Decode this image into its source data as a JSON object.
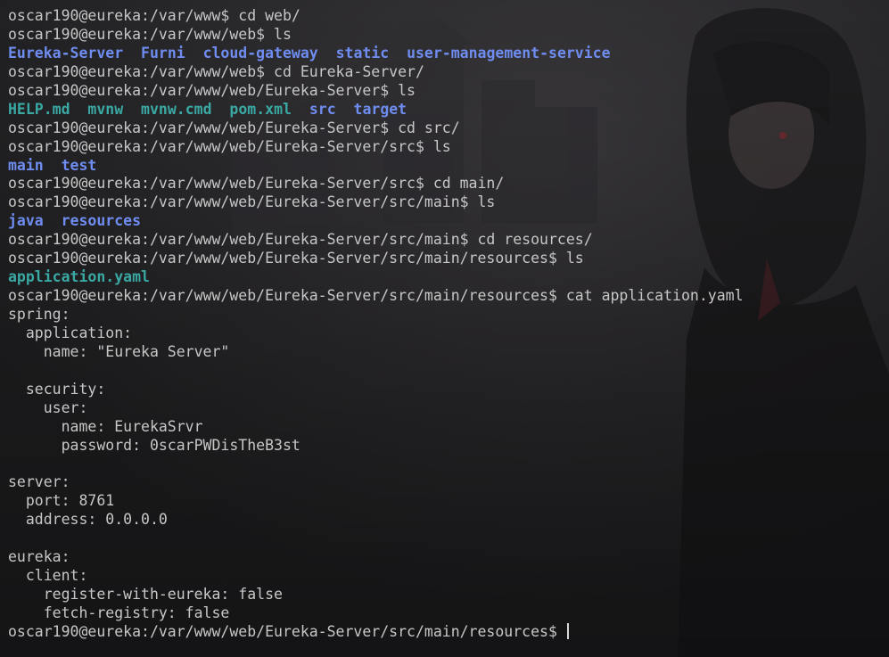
{
  "terminal": {
    "colors": {
      "background": "#232325",
      "text": "#c7c7c7",
      "directory": "#6f8cf0",
      "file": "#3aa8a3"
    },
    "lines": [
      {
        "type": "text",
        "text": "oscar190@eureka:/var/www$ cd web/"
      },
      {
        "type": "text",
        "text": "oscar190@eureka:/var/www/web$ ls"
      },
      {
        "type": "ls",
        "items": [
          {
            "name": "Eureka-Server",
            "kind": "dir"
          },
          {
            "name": "Furni",
            "kind": "dir"
          },
          {
            "name": "cloud-gateway",
            "kind": "dir"
          },
          {
            "name": "static",
            "kind": "dir"
          },
          {
            "name": "user-management-service",
            "kind": "dir"
          }
        ]
      },
      {
        "type": "text",
        "text": "oscar190@eureka:/var/www/web$ cd Eureka-Server/"
      },
      {
        "type": "text",
        "text": "oscar190@eureka:/var/www/web/Eureka-Server$ ls"
      },
      {
        "type": "ls",
        "items": [
          {
            "name": "HELP.md",
            "kind": "file"
          },
          {
            "name": "mvnw",
            "kind": "file"
          },
          {
            "name": "mvnw.cmd",
            "kind": "file"
          },
          {
            "name": "pom.xml",
            "kind": "file"
          },
          {
            "name": "src",
            "kind": "dir"
          },
          {
            "name": "target",
            "kind": "dir"
          }
        ]
      },
      {
        "type": "text",
        "text": "oscar190@eureka:/var/www/web/Eureka-Server$ cd src/"
      },
      {
        "type": "text",
        "text": "oscar190@eureka:/var/www/web/Eureka-Server/src$ ls"
      },
      {
        "type": "ls",
        "items": [
          {
            "name": "main",
            "kind": "dir"
          },
          {
            "name": "test",
            "kind": "dir"
          }
        ]
      },
      {
        "type": "text",
        "text": "oscar190@eureka:/var/www/web/Eureka-Server/src$ cd main/"
      },
      {
        "type": "text",
        "text": "oscar190@eureka:/var/www/web/Eureka-Server/src/main$ ls"
      },
      {
        "type": "ls",
        "items": [
          {
            "name": "java",
            "kind": "dir"
          },
          {
            "name": "resources",
            "kind": "dir"
          }
        ]
      },
      {
        "type": "text",
        "text": "oscar190@eureka:/var/www/web/Eureka-Server/src/main$ cd resources/"
      },
      {
        "type": "text",
        "text": "oscar190@eureka:/var/www/web/Eureka-Server/src/main/resources$ ls"
      },
      {
        "type": "ls",
        "items": [
          {
            "name": "application.yaml",
            "kind": "file"
          }
        ]
      },
      {
        "type": "text",
        "text": "oscar190@eureka:/var/www/web/Eureka-Server/src/main/resources$ cat application.yaml"
      },
      {
        "type": "text",
        "text": "spring:"
      },
      {
        "type": "text",
        "text": "  application:"
      },
      {
        "type": "text",
        "text": "    name: \"Eureka Server\""
      },
      {
        "type": "text",
        "text": ""
      },
      {
        "type": "text",
        "text": "  security:"
      },
      {
        "type": "text",
        "text": "    user:"
      },
      {
        "type": "text",
        "text": "      name: EurekaSrvr"
      },
      {
        "type": "text",
        "text": "      password: 0scarPWDisTheB3st"
      },
      {
        "type": "text",
        "text": ""
      },
      {
        "type": "text",
        "text": "server:"
      },
      {
        "type": "text",
        "text": "  port: 8761"
      },
      {
        "type": "text",
        "text": "  address: 0.0.0.0"
      },
      {
        "type": "text",
        "text": ""
      },
      {
        "type": "text",
        "text": "eureka:"
      },
      {
        "type": "text",
        "text": "  client:"
      },
      {
        "type": "text",
        "text": "    register-with-eureka: false"
      },
      {
        "type": "text",
        "text": "    fetch-registry: false"
      },
      {
        "type": "prompt",
        "text": "oscar190@eureka:/var/www/web/Eureka-Server/src/main/resources$ "
      }
    ]
  }
}
